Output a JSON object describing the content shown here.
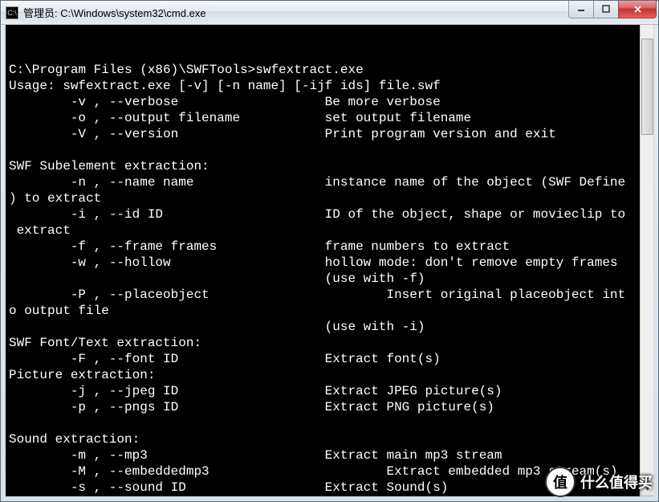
{
  "window": {
    "title": "管理员: C:\\Windows\\system32\\cmd.exe"
  },
  "terminal": {
    "lines": [
      "",
      "C:\\Program Files (x86)\\SWFTools>swfextract.exe",
      "Usage: swfextract.exe [-v] [-n name] [-ijf ids] file.swf",
      "\t-v , --verbose\t\t\t Be more verbose",
      "\t-o , --output filename\t\t set output filename",
      "\t-V , --version\t\t\t Print program version and exit",
      "",
      "SWF Subelement extraction:",
      "\t-n , --name name\t\t instance name of the object (SWF Define",
      ") to extract",
      "\t-i , --id ID\t\t\t ID of the object, shape or movieclip to",
      " extract",
      "\t-f , --frame frames\t\t frame numbers to extract",
      "\t-w , --hollow\t\t\t hollow mode: don't remove empty frames",
      "\t\t\t\t\t (use with -f)",
      "\t-P , --placeobject\t\t\t Insert original placeobject int",
      "o output file",
      "\t\t\t\t\t (use with -i)",
      "SWF Font/Text extraction:",
      "\t-F , --font ID\t\t\t Extract font(s)",
      "Picture extraction:",
      "\t-j , --jpeg ID\t\t\t Extract JPEG picture(s)",
      "\t-p , --pngs ID\t\t\t Extract PNG picture(s)",
      "",
      "Sound extraction:",
      "\t-m , --mp3\t\t\t Extract main mp3 stream",
      "\t-M , --embeddedmp3\t\t\t Extract embedded mp3 stream(s)",
      "\t-s , --sound ID\t\t\t Extract Sound(s)",
      ""
    ]
  },
  "watermark": {
    "badge": "值",
    "text": "什么值得买"
  }
}
